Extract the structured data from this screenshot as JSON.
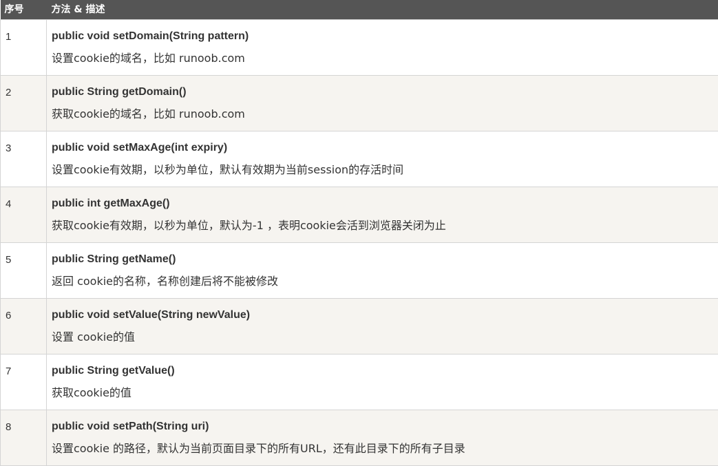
{
  "table": {
    "headers": {
      "index": "序号",
      "method": "方法 & 描述"
    },
    "rows": [
      {
        "index": "1",
        "signature": "public void setDomain(String pattern)",
        "description": "设置cookie的域名，比如 runoob.com"
      },
      {
        "index": "2",
        "signature": "public String getDomain()",
        "description": "获取cookie的域名，比如 runoob.com"
      },
      {
        "index": "3",
        "signature": "public void setMaxAge(int expiry)",
        "description": "设置cookie有效期，以秒为单位，默认有效期为当前session的存活时间"
      },
      {
        "index": "4",
        "signature": "public int getMaxAge()",
        "description": "获取cookie有效期，以秒为单位，默认为-1 ，表明cookie会活到浏览器关闭为止"
      },
      {
        "index": "5",
        "signature": "public String getName()",
        "description": "返回 cookie的名称，名称创建后将不能被修改"
      },
      {
        "index": "6",
        "signature": "public void setValue(String newValue)",
        "description": "设置 cookie的值"
      },
      {
        "index": "7",
        "signature": "public String getValue()",
        "description": "获取cookie的值"
      },
      {
        "index": "8",
        "signature": "public void setPath(String uri)",
        "description": "设置cookie 的路径，默认为当前页面目录下的所有URL，还有此目录下的所有子目录"
      }
    ]
  },
  "colors": {
    "header_bg": "#555555",
    "header_text": "#ffffff",
    "row_alt_bg": "#f6f4f0",
    "row_bg": "#ffffff",
    "border": "#d4d4d4",
    "text": "#333333"
  }
}
